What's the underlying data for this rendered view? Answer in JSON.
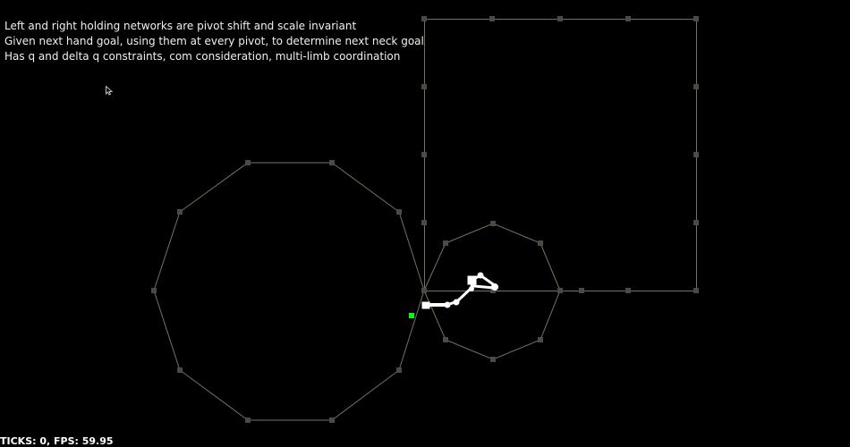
{
  "info": {
    "lines": [
      "Left and right holding networks are pivot shift and scale invariant",
      "Given next hand goal, using them at every pivot, to determine next neck goal",
      "Has q and delta q constraints, com consideration, multi-limb coordination"
    ]
  },
  "status": {
    "text": "TICKS: 0, FPS: 59.95"
  },
  "colors": {
    "background": "#000000",
    "outline": "#76745a",
    "vertex": "#4a4a4a",
    "robot": "#ffffff",
    "goal": "#00ff00"
  },
  "icons": {
    "cursor": "mouse-pointer-icon",
    "goal": "goal-marker-icon"
  }
}
